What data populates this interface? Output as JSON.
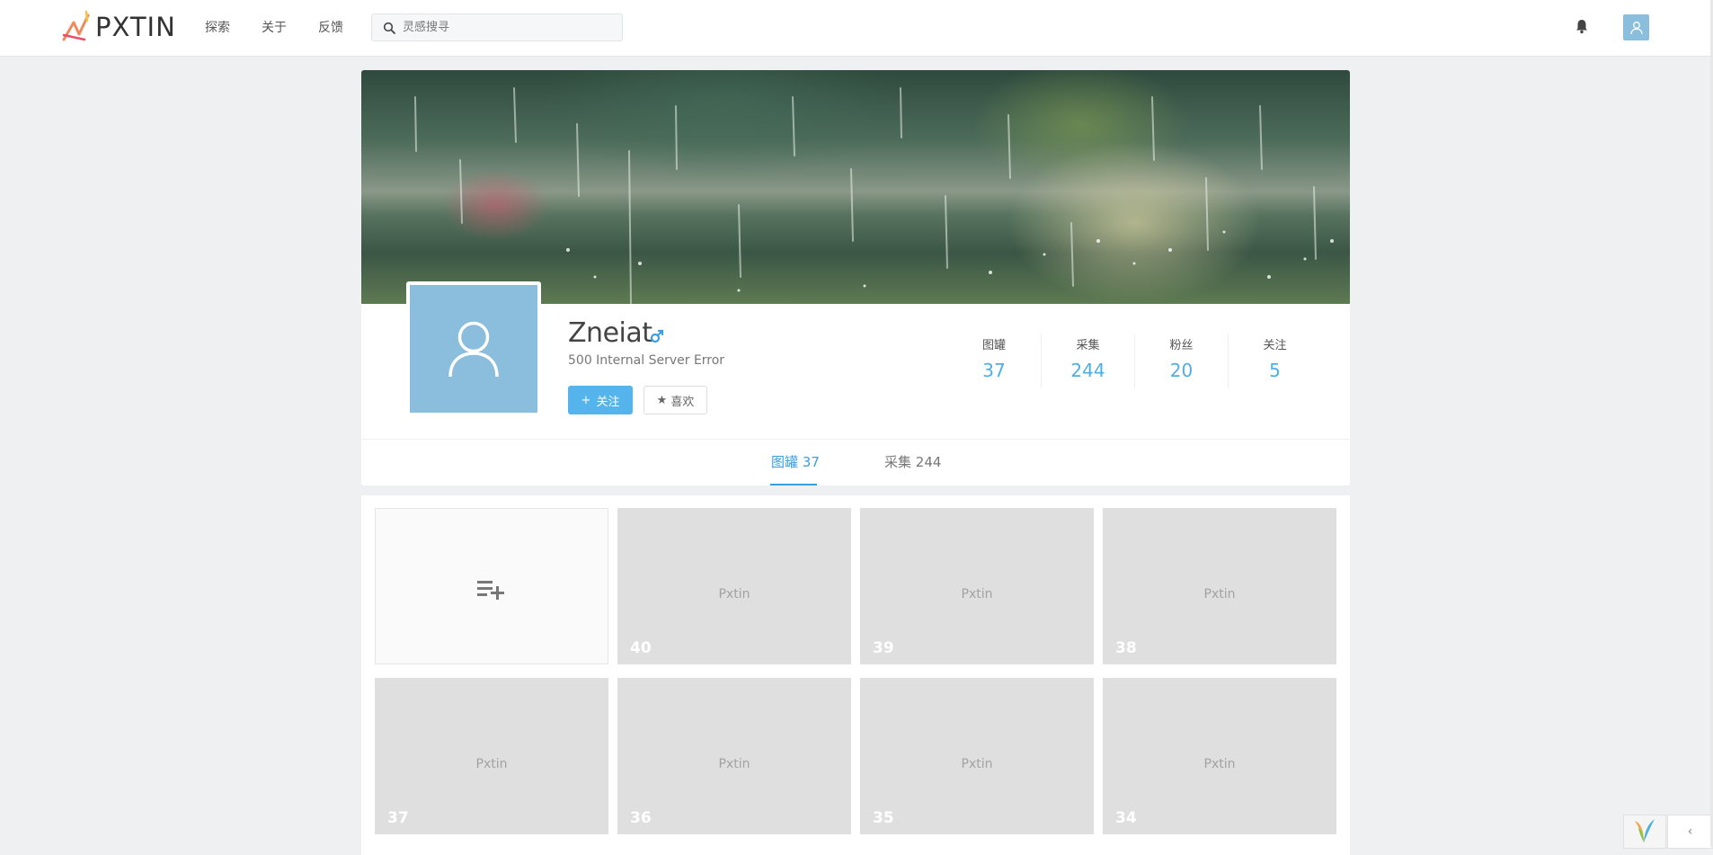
{
  "header": {
    "brand": "PXTIN",
    "nav": [
      "探索",
      "关于",
      "反馈"
    ],
    "search_placeholder": "灵感搜寻"
  },
  "profile": {
    "name": "Zneiat",
    "bio": "500 Internal Server Error",
    "follow_label": "关注",
    "like_label": "喜欢",
    "stats": [
      {
        "label": "图罐",
        "value": "37"
      },
      {
        "label": "采集",
        "value": "244"
      },
      {
        "label": "粉丝",
        "value": "20"
      },
      {
        "label": "关注",
        "value": "5"
      }
    ]
  },
  "tabs": [
    {
      "label": "图罐",
      "count": "37",
      "active": true
    },
    {
      "label": "采集",
      "count": "244",
      "active": false
    }
  ],
  "tiles": [
    {
      "text": "Pxtin",
      "number": "40"
    },
    {
      "text": "Pxtin",
      "number": "39"
    },
    {
      "text": "Pxtin",
      "number": "38"
    },
    {
      "text": "Pxtin",
      "number": "37"
    },
    {
      "text": "Pxtin",
      "number": "36"
    },
    {
      "text": "Pxtin",
      "number": "35"
    },
    {
      "text": "Pxtin",
      "number": "34"
    }
  ],
  "colors": {
    "accent": "#4eaee6",
    "avatar_bg": "#8bbedc",
    "follow_button": "#56b4ec"
  }
}
